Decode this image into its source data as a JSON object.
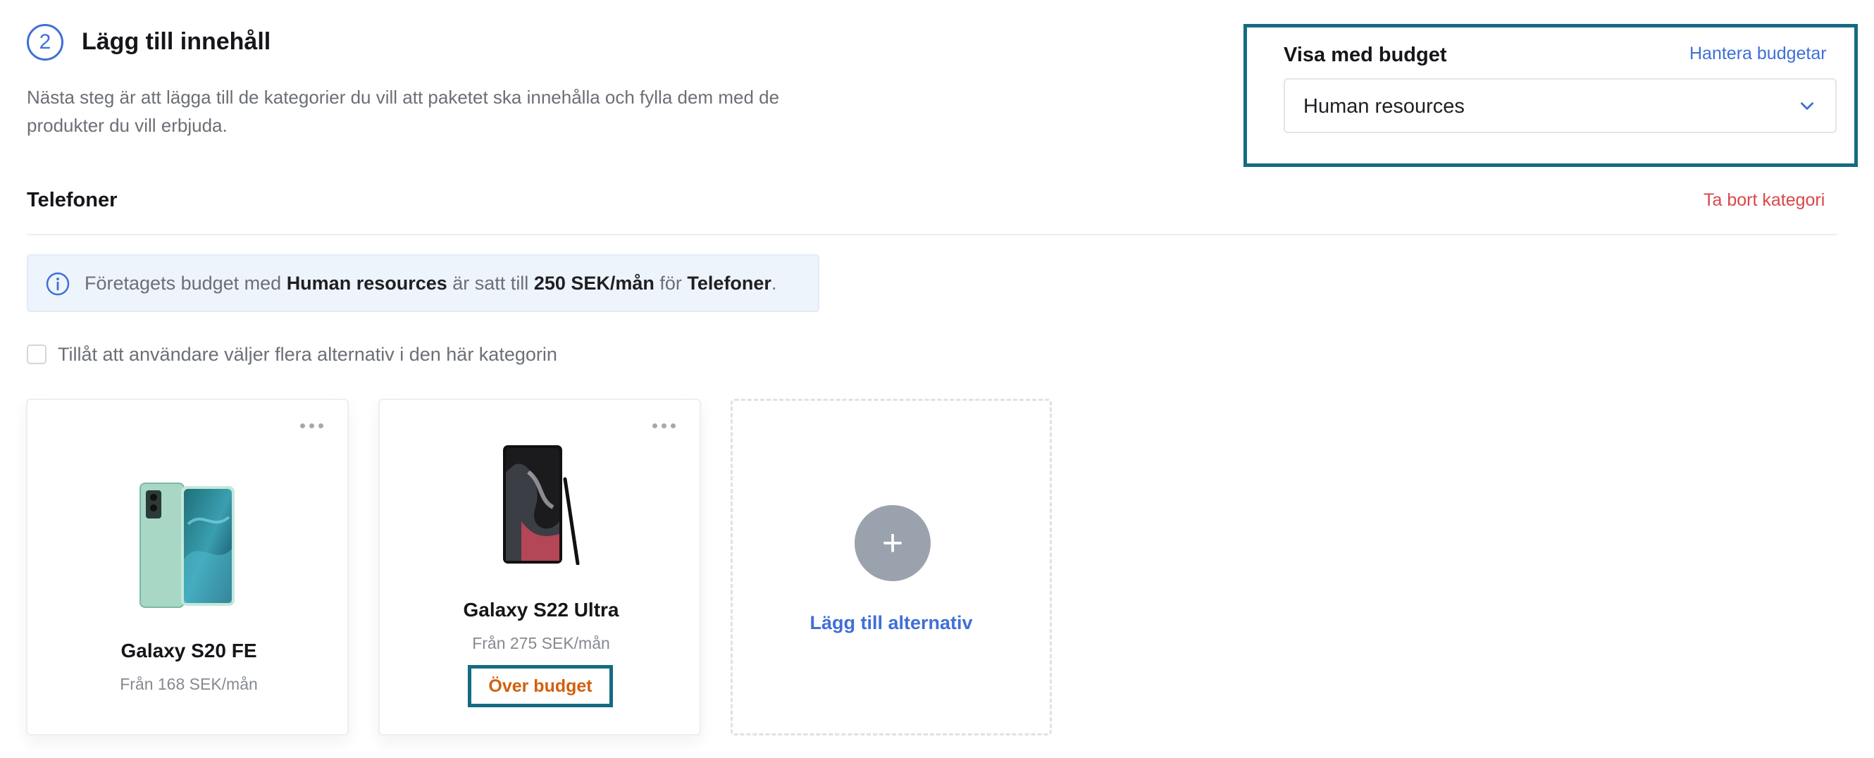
{
  "step": {
    "number": "2",
    "title": "Lägg till innehåll",
    "description": "Nästa steg är att lägga till de kategorier du vill att paketet ska innehålla och fylla dem med de produkter du vill erbjuda."
  },
  "budget": {
    "label": "Visa med budget",
    "manage_link": "Hantera budgetar",
    "selected": "Human resources"
  },
  "category": {
    "title": "Telefoner",
    "remove_link": "Ta bort kategori",
    "info": {
      "prefix": "Företagets budget med ",
      "budget_name": "Human resources",
      "middle": " är satt till ",
      "amount": "250 SEK/mån",
      "for_text": " för ",
      "category": "Telefoner",
      "suffix": "."
    },
    "allow_multiple_label": "Tillåt att användare väljer flera alternativ i den här kategorin",
    "allow_multiple_checked": false,
    "products": [
      {
        "name": "Galaxy S20 FE",
        "price": "Från 168 SEK/mån",
        "image": "phone-green-image"
      },
      {
        "name": "Galaxy S22 Ultra",
        "price": "Från 275 SEK/mån",
        "image": "phone-black-stylus-image",
        "badge": "Över budget"
      }
    ],
    "add_option_label": "Lägg till alternativ"
  },
  "colors": {
    "accent_blue": "#3f6fd8",
    "highlight_teal": "#146b83",
    "danger_red": "#d9474b",
    "warning_orange": "#d2600e",
    "muted_gray": "#9aa3ad"
  },
  "icons": [
    "info-icon",
    "chevron-down-icon",
    "more-icon",
    "plus-icon"
  ]
}
